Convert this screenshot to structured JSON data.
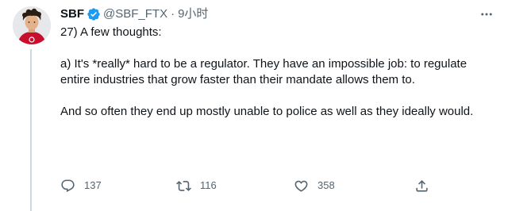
{
  "tweet": {
    "author_name": "SBF",
    "handle": "@SBF_FTX",
    "separator": "·",
    "time": "9小时",
    "paragraphs": [
      "27) A few thoughts:",
      "a) It's *really* hard to be a regulator.  They have an impossible job: to regulate entire industries that grow faster than their mandate allows them to.",
      "And so often they end up mostly unable to police as well as they ideally would."
    ]
  },
  "actions": {
    "replies": "137",
    "retweets": "116",
    "likes": "358"
  },
  "icons": {
    "verified": "verified-badge-icon",
    "more": "more-options-icon",
    "reply": "reply-icon",
    "retweet": "retweet-icon",
    "like": "heart-icon",
    "share": "share-icon"
  },
  "colors": {
    "text": "#0f1419",
    "secondary": "#536471",
    "verified": "#1d9bf0",
    "thread_line": "#cfd9de",
    "avatar_shirt": "#c8102e"
  }
}
